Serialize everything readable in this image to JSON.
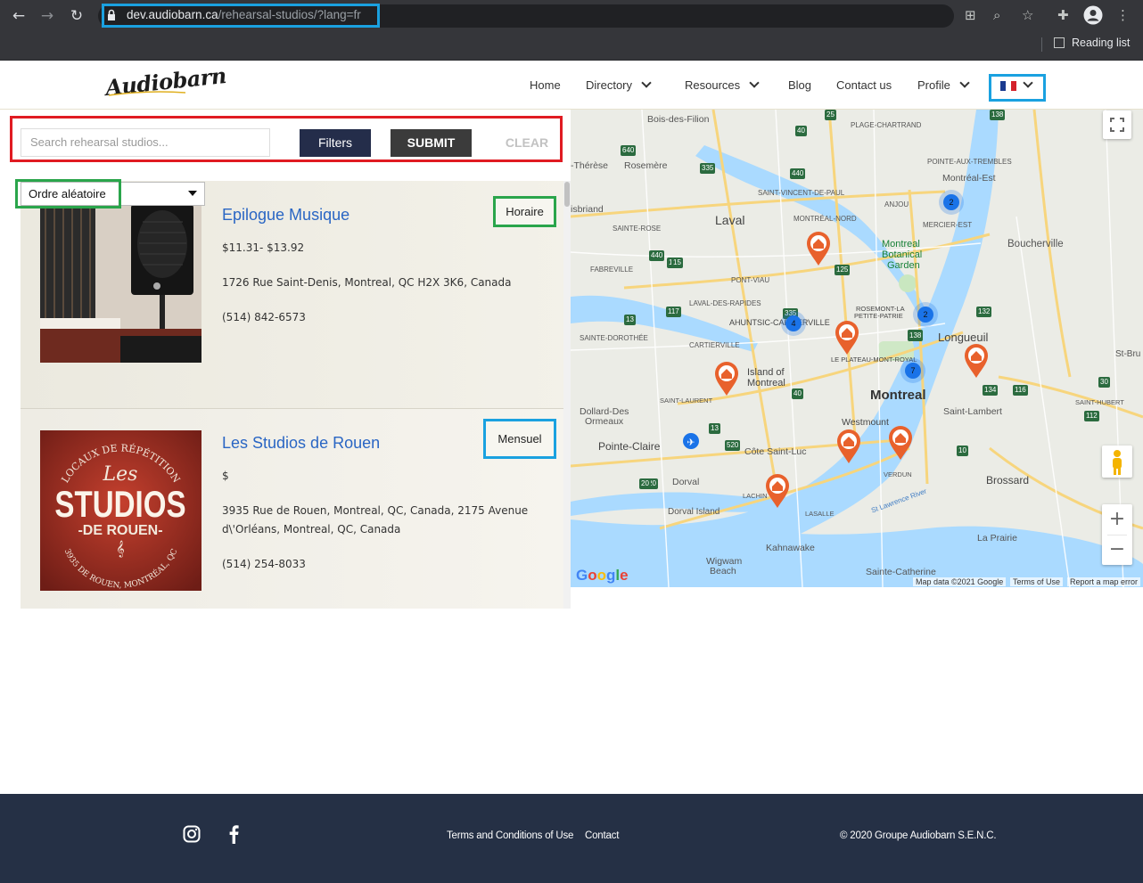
{
  "browser": {
    "url_host": "dev.audiobarn.ca",
    "url_path": "/rehearsal-studios/?lang=fr",
    "reading_list": "Reading list"
  },
  "header": {
    "logo": "Audiobarn",
    "menu": [
      {
        "label": "Home"
      },
      {
        "label": "Directory"
      },
      {
        "label": "Resources"
      },
      {
        "label": "Blog"
      },
      {
        "label": "Contact us"
      },
      {
        "label": "Profile"
      }
    ],
    "flag_colors": [
      "#1a3a8f",
      "#ffffff",
      "#d4222b"
    ]
  },
  "search": {
    "placeholder": "Search rehearsal studios...",
    "filters_label": "Filters",
    "submit_label": "SUBMIT",
    "clear_label": "CLEAR"
  },
  "sort": {
    "selected": "Ordre aléatoire"
  },
  "listings": [
    {
      "title": "Epilogue Musique",
      "price": "$11.31- $13.92",
      "address": "1726 Rue Saint-Denis, Montreal, QC H2X 3K6, Canada",
      "phone": "(514) 842-6573",
      "tag": "Horaire"
    },
    {
      "title": "Les Studios de Rouen",
      "price": "$",
      "address_line1": "3935 Rue de Rouen, Montreal, QC, Canada, 2175 Avenue",
      "address_line2": "d\\'Orléans, Montreal, QC, Canada",
      "phone": "(514) 254-8033",
      "tag": "Mensuel",
      "image_text": {
        "arc_top": "LOCAUX DE RÉPÉTITION",
        "les": "Les",
        "studios": "STUDIOS",
        "de_rouen": "-DE ROUEN-",
        "arc_bottom": "3935 DE ROUEN, MONTRÉAL, QC"
      }
    }
  ],
  "map": {
    "labels": {
      "bois_des_filion": "Bois-des-Filion",
      "plage_chartrand": "PLAGE-CHARTRAND",
      "therese": "-Thérèse",
      "rosemere": "Rosemère",
      "pointe_aux_trembles": "POINTE-AUX-TREMBLES",
      "montreal_est": "Montréal-Est",
      "saint_vincent": "SAINT-VINCENT-DE-PAUL",
      "boisbriand": "isbriand",
      "anjou": "ANJOU",
      "laval": "Laval",
      "montreal_nord": "MONTRÉAL-NORD",
      "mercier_est": "MERCIER-EST",
      "sainte_rose": "SAINTE-ROSE",
      "boucherville": "Boucherville",
      "fabreville": "FABREVILLE",
      "botanical_1": "Montreal",
      "botanical_2": "Botanical",
      "botanical_3": "Garden",
      "pont_viau": "PONT-VIAU",
      "laval_rapides": "LAVAL-DES-RAPIDES",
      "ahuntsic": "AHUNTSIC-CARTIERVILLE",
      "rosemont_1": "ROSEMONT-LA",
      "rosemont_2": "PETITE-PATRIE",
      "sainte_dorothee": "SAINTE-DOROTHÉE",
      "longueuil": "Longueuil",
      "cartierville": "CARTIERVILLE",
      "plateau": "LE PLATEAU-MONT-ROYAL",
      "st_bru": "St-Bru",
      "island_1": "Island of",
      "island_2": "Montreal",
      "montreal": "Montreal",
      "saint_laurent": "SAINT-LAURENT",
      "saint_hubert": "SAINT-HUBERT",
      "dollard_1": "Dollard-Des",
      "dollard_2": "Ormeaux",
      "saint_lambert": "Saint-Lambert",
      "westmount": "Westmount",
      "pointe_claire": "Pointe-Claire",
      "cote_saint_luc": "Côte Saint-Luc",
      "verdun": "VERDUN",
      "brossard": "Brossard",
      "dorval": "Dorval",
      "lachine": "LACHIN",
      "st_lawrence": "St Lawrence River",
      "dorval_island": "Dorval Island",
      "lasalle": "LASALLE",
      "la_prairie": "La Prairie",
      "kahnawake": "Kahnawake",
      "wigwam_1": "Wigwam",
      "wigwam_2": "Beach",
      "sainte_catherine": "Sainte-Catherine"
    },
    "clusters": [
      "2",
      "4",
      "2",
      "7"
    ],
    "highway_shields": [
      "25",
      "640",
      "335",
      "440",
      "138",
      "40",
      "15",
      "125",
      "440",
      "15",
      "117",
      "13",
      "335",
      "138",
      "132",
      "40",
      "134",
      "116",
      "112",
      "13",
      "520",
      "20",
      "20",
      "10",
      "30",
      "138"
    ],
    "google": "Google",
    "attribution": "Map data ©2021 Google",
    "terms": "Terms of Use",
    "report": "Report a map error"
  },
  "footer": {
    "terms": "Terms and Conditions of Use",
    "contact": "Contact",
    "copyright": "© 2020 Groupe Audiobarn S.E.N.C."
  },
  "colors": {
    "footer_bg": "#253045",
    "link_blue": "#2a66c4",
    "filters_bg": "#242d4a",
    "submit_bg": "#3b3b3b",
    "annotation_red": "#e01b22",
    "annotation_blue": "#1aa1e0",
    "annotation_green": "#2aa54b",
    "pin_orange": "#e8612c",
    "cluster_blue": "#1a73e8"
  }
}
